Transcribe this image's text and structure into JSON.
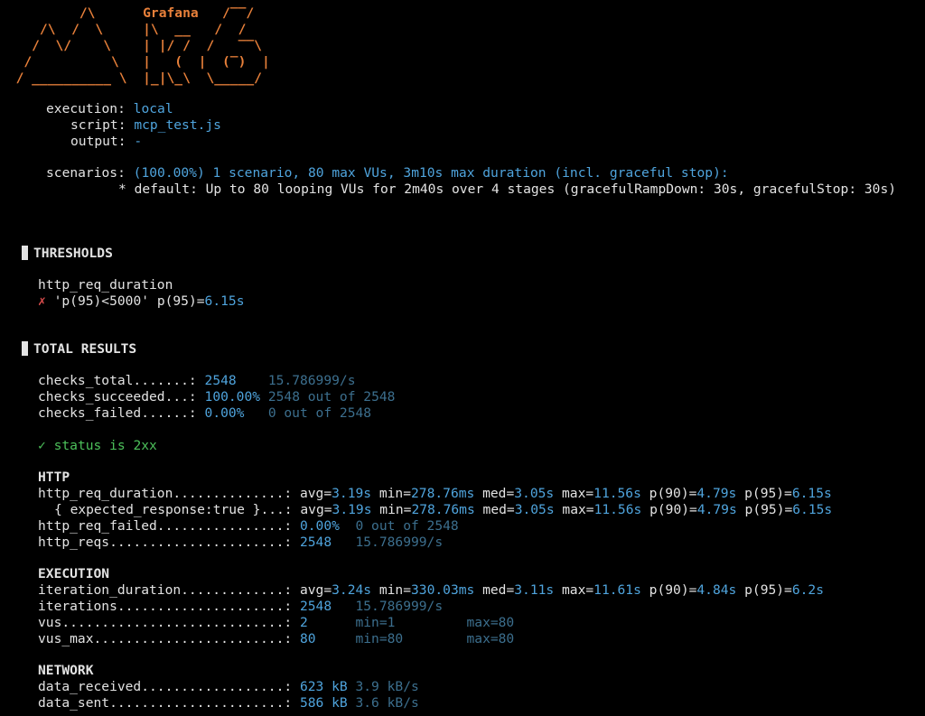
{
  "colors": {
    "background": "#000000",
    "text": "#e3e3e3",
    "logo": "#e8803a",
    "value": "#4fa4dd",
    "rate": "#3c6f8e",
    "fail": "#d94c4c",
    "pass": "#4cc05a"
  },
  "logo_lines": [
    "          /\\      Grafana   /‾‾/",
    "     /\\  /  \\     |\\  __   /  /",
    "    /  \\/    \\    | |/ /  /   ‾‾\\",
    "   /          \\   |   (  |  (‾)  |",
    "  / __________ \\  |_|\\_\\  \\_____/"
  ],
  "header": {
    "execution": {
      "label": "execution:",
      "value": "local"
    },
    "script": {
      "label": "script:",
      "value": "mcp_test.js"
    },
    "output": {
      "label": "output:",
      "value": "-"
    },
    "scenarios": {
      "label": "scenarios:",
      "value": "(100.00%) 1 scenario, 80 max VUs, 3m10s max duration (incl. graceful stop):"
    },
    "default_line": "* default: Up to 80 looping VUs for 2m40s over 4 stages (gracefulRampDown: 30s, gracefulStop: 30s)"
  },
  "thresholds": {
    "title": "THRESHOLDS",
    "metric": "http_req_duration",
    "fail_icon": "✗",
    "rule": "'p(95)<5000'",
    "result_label": "p(95)=",
    "result_value": "6.15s"
  },
  "total_results": {
    "title": "TOTAL RESULTS",
    "checks": [
      {
        "name": "checks_total.......:",
        "value": "2548",
        "extra": "15.786999/s"
      },
      {
        "name": "checks_succeeded...:",
        "value": "100.00%",
        "extra": "2548 out of 2548"
      },
      {
        "name": "checks_failed......:",
        "value": "0.00%",
        "extra": "0 out of 2548"
      }
    ],
    "status_check": {
      "icon": "✓",
      "label": "status is 2xx"
    }
  },
  "http": {
    "title": "HTTP",
    "req_duration": {
      "name": "http_req_duration..............:",
      "avg": "3.19s",
      "min": "278.76ms",
      "med": "3.05s",
      "max": "11.56s",
      "p90": "4.79s",
      "p95": "6.15s"
    },
    "expected_response": {
      "name": "{ expected_response:true }...:",
      "avg": "3.19s",
      "min": "278.76ms",
      "med": "3.05s",
      "max": "11.56s",
      "p90": "4.79s",
      "p95": "6.15s"
    },
    "req_failed": {
      "name": "http_req_failed................:",
      "value": "0.00%",
      "extra": "0 out of 2548"
    },
    "reqs": {
      "name": "http_reqs......................:",
      "value": "2548",
      "extra": "15.786999/s"
    }
  },
  "execution": {
    "title": "EXECUTION",
    "iteration_duration": {
      "name": "iteration_duration.............:",
      "avg": "3.24s",
      "min": "330.03ms",
      "med": "3.11s",
      "max": "11.61s",
      "p90": "4.84s",
      "p95": "6.2s"
    },
    "iterations": {
      "name": "iterations.....................:",
      "value": "2548",
      "extra": "15.786999/s"
    },
    "vus": {
      "name": "vus............................:",
      "value": "2",
      "min": "min=1",
      "max": "max=80"
    },
    "vus_max": {
      "name": "vus_max........................:",
      "value": "80",
      "min": "min=80",
      "max": "max=80"
    }
  },
  "network": {
    "title": "NETWORK",
    "received": {
      "name": "data_received..................:",
      "value": "623 kB",
      "extra": "3.9 kB/s"
    },
    "sent": {
      "name": "data_sent......................:",
      "value": "586 kB",
      "extra": "3.6 kB/s"
    }
  },
  "stat_labels": {
    "avg": "avg=",
    "min": "min=",
    "med": "med=",
    "max": "max=",
    "p90": "p(90)=",
    "p95": "p(95)="
  }
}
